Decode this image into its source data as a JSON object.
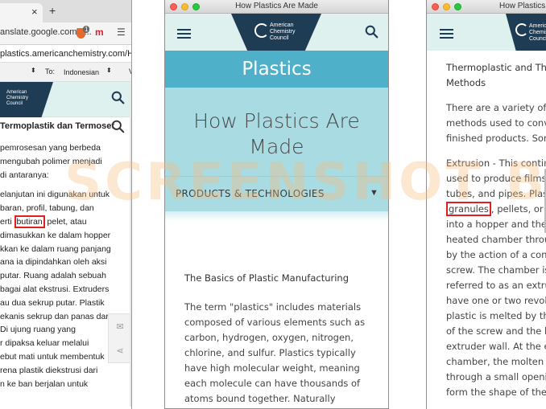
{
  "watermark": "SCREENSHOT BY",
  "left_window": {
    "tab_close": "×",
    "new_tab": "+",
    "url": "anslate.google.com/tr...",
    "shield_badge": "1",
    "ext_label": "m",
    "menu_icon": "☰",
    "site_url": "plastics.americanchemistry.com/How-Pla",
    "lang_from_arrow": "⬍",
    "lang_to_label": "To:",
    "lang_to_value": "Indonesian",
    "lang_to_arrow": "⬍",
    "lang_extra": "V",
    "logo_text": [
      "American",
      "Chemistry",
      "Council"
    ],
    "subhead": "Termoplastik dan Termoset",
    "lines_before_box": [
      "pemrosesan yang berbeda",
      "mengubah polimer menjadi",
      "di antaranya:",
      "",
      "elanjutan ini digunakan untuk",
      "baran, profil, tabung, dan"
    ],
    "box_line": {
      "before": "erti ",
      "boxed": "butiran",
      "after": " pelet, atau"
    },
    "lines_after_box": [
      "dimasukkan ke dalam hopper",
      "kkan ke dalam ruang panjang",
      "ana ia dipindahkan oleh aksi",
      "putar. Ruang adalah sebuah",
      "bagai alat ekstrusi. Extruders",
      "au dua sekrup putar. Plastik",
      "ekanis sekrup dan panas dar",
      "Di ujung ruang yang",
      "r dipaksa keluar melalui",
      "ebut mati untuk membentuk",
      "rena plastik diekstrusi dari",
      "n ke ban berjalan untuk"
    ],
    "social_icons": [
      "email-icon",
      "share-icon"
    ]
  },
  "middle_window": {
    "window_title": "How Plastics Are Made",
    "logo_text": [
      "American",
      "Chemistry",
      "Council"
    ],
    "section_title": "Plastics",
    "hero_title": "How Plastics Are Made",
    "dropdown_label": "PRODUCTS & TECHNOLOGIES",
    "dropdown_arrow": "▼",
    "subheading": "The Basics of Plastic Manufacturing",
    "paragraph": "The term \"plastics\" includes materials composed of various elements such as carbon, hydrogen, oxygen, nitrogen, chlorine, and sulfur. Plastics typically have high molecular weight, meaning each molecule can have thousands of atoms bound together. Naturally occurring"
  },
  "right_window": {
    "window_title": "How Plastics A",
    "logo_text": [
      "Americ",
      "Chemis",
      "Counci"
    ],
    "heading_lines": [
      "Thermoplastic and Ther",
      "Methods"
    ],
    "para1_lines": [
      "There are a variety of di",
      "methods used to conver",
      "finished products. Some"
    ],
    "lines_before_box": [
      "Extrusion - This continu",
      "used to produce films, s",
      "tubes, and pipes. Plastic"
    ],
    "box_line": {
      "boxed": "granules",
      "after": ", pellets, or pow"
    },
    "lines_after_box": [
      "into a hopper and then f",
      "heated chamber throug",
      "by the action of a contin",
      "screw. The chamber is a",
      "referred to as an extrud",
      "have one or two revolvin",
      "plastic is melted by the",
      "of the screw and the hea",
      "extruder wall. At the en",
      "chamber, the molten pla",
      "through a small opening",
      "form the shape of the fi"
    ]
  }
}
